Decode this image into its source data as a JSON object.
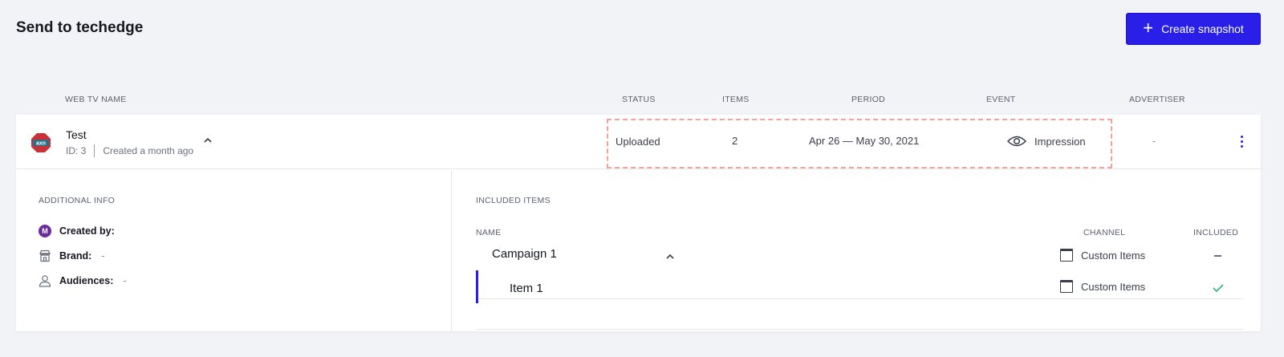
{
  "page": {
    "title": "Send to techedge"
  },
  "toolbar": {
    "create_label": "Create snapshot"
  },
  "columns": {
    "web_tv_name": "WEB TV NAME",
    "status": "STATUS",
    "items": "ITEMS",
    "period": "PERIOD",
    "event": "EVENT",
    "advertiser": "ADVERTISER"
  },
  "row": {
    "logo_text": "axn",
    "name": "Test",
    "id": "ID: 3",
    "created": "Created a month ago",
    "status": "Uploaded",
    "items": "2",
    "period": "Apr 26 — May 30, 2021",
    "event": "Impression",
    "advertiser": "-"
  },
  "additional_info": {
    "title": "ADDITIONAL INFO",
    "created_by_avatar": "M",
    "created_by_label": "Created by:",
    "brand_label": "Brand:",
    "brand_value": "-",
    "audiences_label": "Audiences:",
    "audiences_value": "-"
  },
  "included_items": {
    "title": "INCLUDED ITEMS",
    "headers": {
      "name": "NAME",
      "channel": "CHANNEL",
      "included": "INCLUDED"
    },
    "campaign": {
      "name": "Campaign 1",
      "channel": "Custom Items"
    },
    "item": {
      "name": "Item 1",
      "channel": "Custom Items"
    }
  },
  "colors": {
    "accent": "#2a1fe8",
    "highlight_dash": "#f0a59a",
    "avatar": "#6b2a9e",
    "check": "#2eb872"
  }
}
